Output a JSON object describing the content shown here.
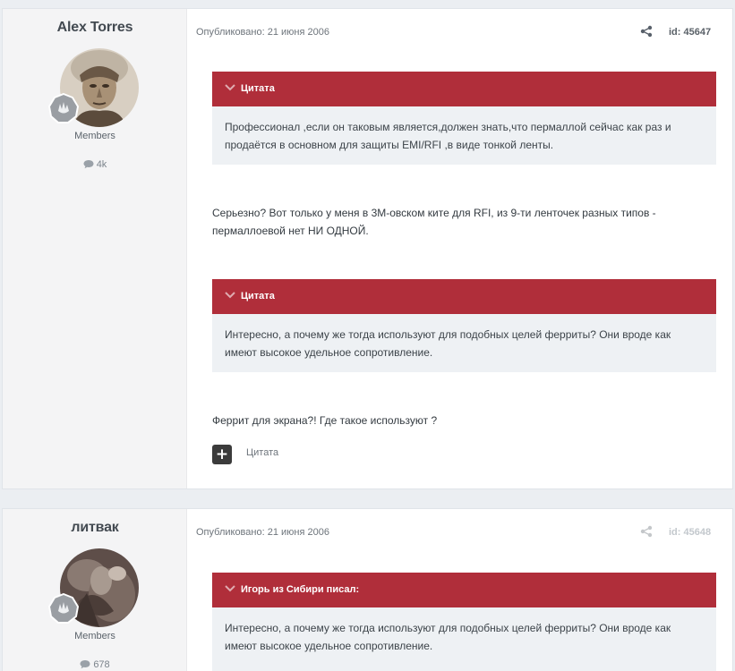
{
  "posts": [
    {
      "author": "Alex Torres",
      "group": "Members",
      "post_count": "4k",
      "date": "Опубликовано: 21 июня 2006",
      "id_label": "id: 45647",
      "quote1": {
        "header": "Цитата",
        "body": "Профессионал ,если он таковым является,должен знать,что пермаллой сейчас как раз и продаётся в основном для защиты EMI/RFI ,в виде тонкой ленты."
      },
      "reply1": "Серьезно? Вот только у меня в 3М-овском ките для RFI, из 9-ти ленточек разных типов - пермаллоевой нет НИ ОДНОЙ.",
      "quote2": {
        "header": "Цитата",
        "body": "Интересно, а почему же тогда используют для подобных целей ферриты? Они вроде как имеют высокое удельное сопротивление."
      },
      "reply2": "Феррит для экрана?! Где такое используют ?",
      "add_quote_symbol": "+",
      "quote_action": "Цитата"
    },
    {
      "author": "литвак",
      "group": "Members",
      "post_count": "678",
      "date": "Опубликовано: 21 июня 2006",
      "id_label": "id: 45648",
      "quote1": {
        "header": "Игорь из Сибири писал:",
        "body": "Интересно, а почему же тогда используют для подобных целей ферриты? Они вроде как имеют высокое удельное сопротивление."
      }
    }
  ],
  "colors": {
    "quote_header": "#b02e3a",
    "quote_body_bg": "#eef1f4",
    "author_panel_bg": "#f4f4f5"
  },
  "icons": [
    "share-icon",
    "comment-icon",
    "chevron-down-icon",
    "rank-badge-icon"
  ]
}
